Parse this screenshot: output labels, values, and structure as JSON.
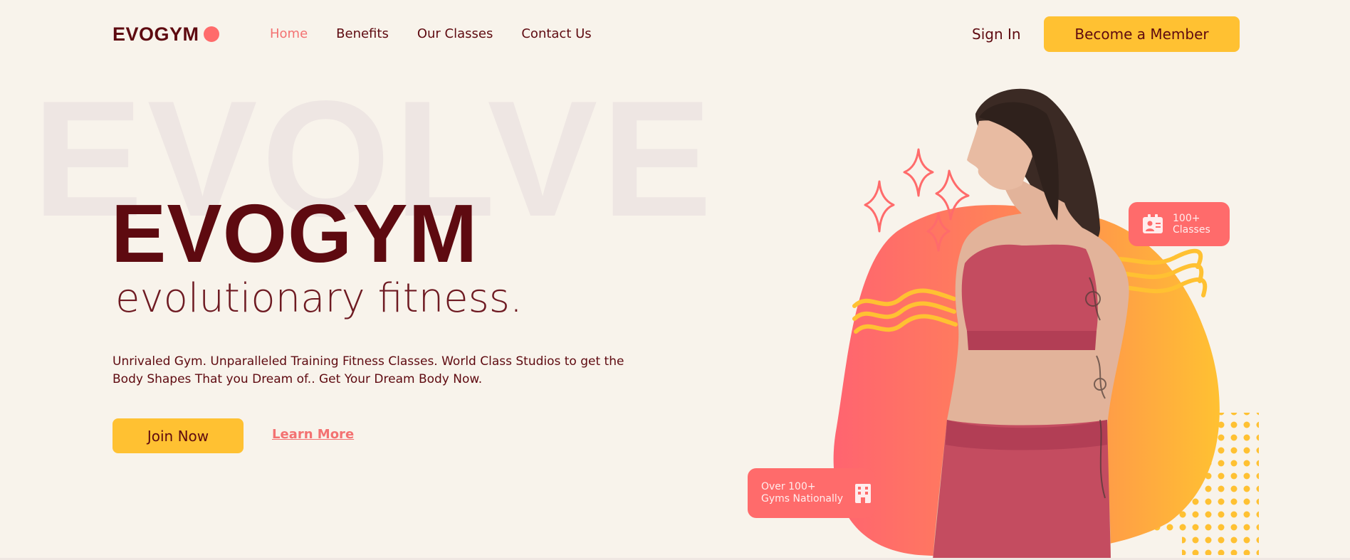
{
  "nav": {
    "logo": "EVOGYM",
    "links": [
      "Home",
      "Benefits",
      "Our Classes",
      "Contact Us"
    ],
    "active_link": "Home",
    "sign_in": "Sign In",
    "cta": "Become a Member"
  },
  "hero": {
    "background_word": "EVOLVE",
    "title": "EVOGYM",
    "subtitle": "evolutionary fitness.",
    "description": "Unrivaled Gym. Unparalleled Training Fitness Classes. World Class Studios to get the Body Shapes That you Dream of.. Get Your Dream Body Now.",
    "primary_button": "Join Now",
    "secondary_link": "Learn More"
  },
  "stats": {
    "classes_line1": "100+",
    "classes_line2": "Classes",
    "gyms_line1": "Over 100+",
    "gyms_line2": "Gyms Nationally"
  },
  "colors": {
    "background": "#F8F3EB",
    "primary": "#5E0A10",
    "accent_red": "#FF6B6B",
    "accent_yellow": "#FFC132"
  },
  "icons": [
    "brand-dot-icon",
    "sparkle-icon",
    "wave-icon",
    "id-card-icon",
    "building-icon",
    "dot-grid-icon"
  ]
}
